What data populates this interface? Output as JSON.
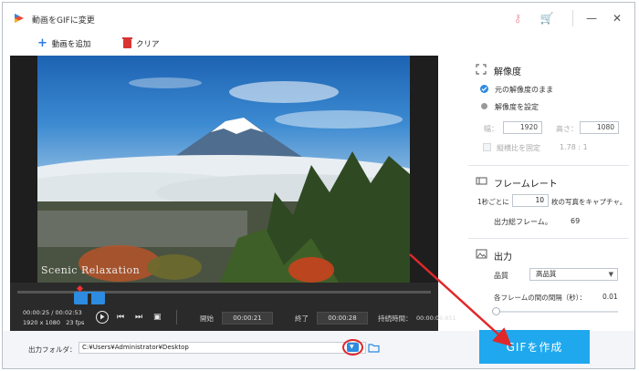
{
  "titlebar": {
    "title": "動画をGIFに変更"
  },
  "toolbar": {
    "add_label": "動画を追加",
    "clear_label": "クリア"
  },
  "player": {
    "watermark": "Scenic Relaxation",
    "current_time": "00:00:25",
    "total_time": "00:02:53",
    "resolution": "1920 x 1080",
    "fps": "23 fps",
    "start_label": "開始",
    "start_time": "00:00:21",
    "end_label": "終了",
    "end_time": "00:00:28",
    "duration_label": "持続時間：",
    "duration_value": "00:00:06.851"
  },
  "resolution": {
    "heading": "解像度",
    "option_keep": "元の解像度のまま",
    "option_set": "解像度を設定",
    "width_label": "幅：",
    "width_value": "1920",
    "height_label": "高さ：",
    "height_value": "1080",
    "ratio_label": "縦横比を固定",
    "ratio_value": "1.78 : 1"
  },
  "framerate": {
    "heading": "フレームレート",
    "per_sec_prefix": "1秒ごとに",
    "per_sec_value": "10",
    "per_sec_suffix": "枚の写真をキャプチャ。",
    "total_label": "出力総フレーム。",
    "total_value": "69"
  },
  "output": {
    "heading": "出力",
    "quality_label": "品質",
    "quality_value": "高品質",
    "interval_label": "各フレームの間の間隔（秒）：",
    "interval_value": "0.01",
    "interval_level": 0.0
  },
  "bottom": {
    "folder_label": "出力フォルダ：",
    "folder_path": "C:¥Users¥Administrator¥Desktop",
    "create_label": "GIFを作成"
  },
  "colors": {
    "accent": "#1fa8ee",
    "annotation": "#e0282a"
  }
}
